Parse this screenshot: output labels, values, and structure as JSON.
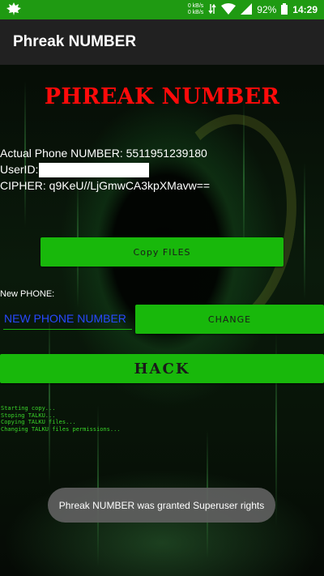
{
  "status_bar": {
    "app_icon": "leaf-icon",
    "net_speed_up": "0 kB/s",
    "net_speed_down": "0 kB/s",
    "battery": "92%",
    "time": "14:29"
  },
  "app_bar": {
    "title": "Phreak NUMBER"
  },
  "main": {
    "heading": "PHREAK NUMBER",
    "actual_phone_label": "Actual Phone NUMBER: 5511951239180",
    "userid_label": "UserID:",
    "cipher_label": "CIPHER: q9KeU//LjGmwCA3kpXMavw==",
    "copy_files_button": "Copy FILES",
    "new_phone_label": "New PHONE:",
    "new_phone_placeholder": "NEW PHONE NUMBER",
    "change_button": "CHANGE",
    "hack_button": "HACK",
    "log_lines": [
      "Starting copy...",
      "Stoping TALKU...",
      "Copying TALKU files...",
      "Changing TALKU files permissions..."
    ]
  },
  "toast": {
    "message": "Phreak NUMBER was granted Superuser rights"
  },
  "colors": {
    "status_bar": "#1f9a12",
    "app_bar": "#212121",
    "accent_button": "#18b80b",
    "heading": "#ff0a0a",
    "placeholder": "#2848ff",
    "log_text": "#3ad62a"
  }
}
